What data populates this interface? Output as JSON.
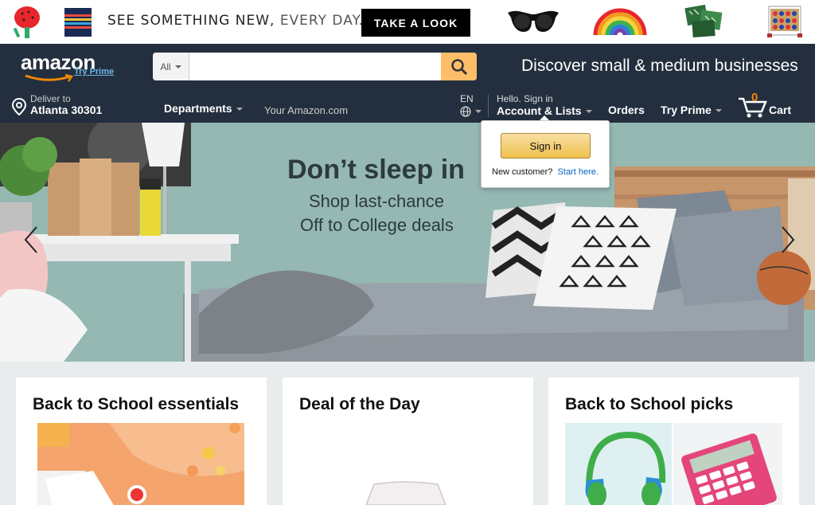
{
  "promo": {
    "text_main": "SEE SOMETHING NEW,",
    "text_thin": "EVERY DAY.",
    "button": "TAKE A LOOK",
    "products": [
      "paddle-icon",
      "bag-icon",
      "sunglasses-icon",
      "rainbow-icon",
      "pillows-icon",
      "connect-four-icon"
    ]
  },
  "header": {
    "logo": "amazon",
    "try_prime": "Try Prime",
    "search_category": "All",
    "search_placeholder": "",
    "discover": "Discover small & medium businesses"
  },
  "nav": {
    "deliver_to": "Deliver to",
    "location": "Atlanta 30301",
    "departments": "Departments",
    "your_amazon": "Your Amazon.com",
    "language": "EN",
    "hello": "Hello. Sign in",
    "account": "Account & Lists",
    "orders": "Orders",
    "try_prime": "Try Prime",
    "cart_count": "0",
    "cart": "Cart"
  },
  "hero": {
    "title": "Don’t sleep in",
    "line1": "Shop last-chance",
    "line2": "Off to College deals"
  },
  "flyout": {
    "signin": "Sign in",
    "new_customer": "New customer?",
    "start_here": "Start here."
  },
  "cards": [
    {
      "title": "Back to School essentials"
    },
    {
      "title": "Deal of the Day"
    },
    {
      "title": "Back to School picks"
    }
  ],
  "colors": {
    "nav_bg": "#232f3e",
    "search_button": "#febd69",
    "accent_orange": "#f08804",
    "link_blue": "#0066c0"
  }
}
